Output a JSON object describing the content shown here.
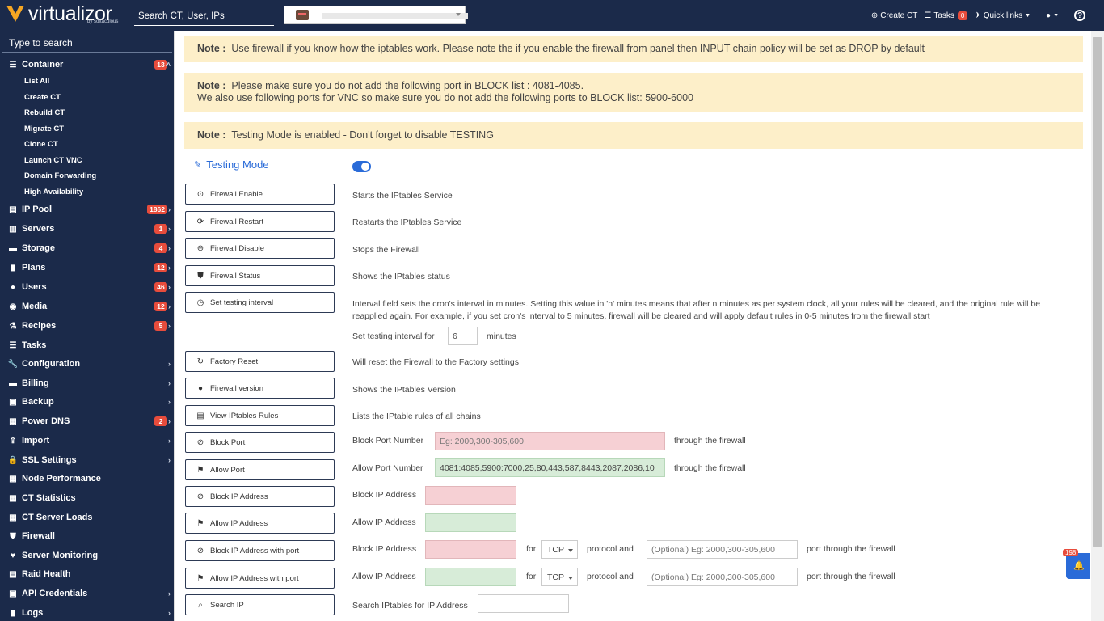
{
  "topbar": {
    "logo_text": "virtualizor",
    "logo_sub": "by softaculous",
    "search_placeholder": "Search CT, User, IPs",
    "create_ct": "Create CT",
    "tasks": "Tasks",
    "tasks_count": "0",
    "quick_links": "Quick links"
  },
  "sidebar": {
    "search_placeholder": "Type to search",
    "items": [
      {
        "label": "Container",
        "badge": "13",
        "icon": "container-icon"
      },
      {
        "label": "IP Pool",
        "badge": "1862",
        "icon": "ip-pool-icon"
      },
      {
        "label": "Servers",
        "badge": "1",
        "icon": "servers-icon"
      },
      {
        "label": "Storage",
        "badge": "4",
        "icon": "storage-icon"
      },
      {
        "label": "Plans",
        "badge": "12",
        "icon": "plans-icon"
      },
      {
        "label": "Users",
        "badge": "46",
        "icon": "users-icon"
      },
      {
        "label": "Media",
        "badge": "12",
        "icon": "media-icon"
      },
      {
        "label": "Recipes",
        "badge": "5",
        "icon": "recipes-icon"
      },
      {
        "label": "Tasks",
        "badge": "",
        "icon": "tasks-icon"
      },
      {
        "label": "Configuration",
        "badge": "",
        "icon": "wrench-icon"
      },
      {
        "label": "Billing",
        "badge": "",
        "icon": "billing-icon"
      },
      {
        "label": "Backup",
        "badge": "",
        "icon": "backup-icon"
      },
      {
        "label": "Power DNS",
        "badge": "2",
        "icon": "dns-icon"
      },
      {
        "label": "Import",
        "badge": "",
        "icon": "import-icon"
      },
      {
        "label": "SSL Settings",
        "badge": "",
        "icon": "lock-icon"
      },
      {
        "label": "Node Performance",
        "badge": "",
        "icon": "chart-icon"
      },
      {
        "label": "CT Statistics",
        "badge": "",
        "icon": "chart-icon"
      },
      {
        "label": "CT Server Loads",
        "badge": "",
        "icon": "chart-icon"
      },
      {
        "label": "Firewall",
        "badge": "",
        "icon": "shield-icon"
      },
      {
        "label": "Server Monitoring",
        "badge": "",
        "icon": "heart-icon"
      },
      {
        "label": "Raid Health",
        "badge": "",
        "icon": "raid-icon"
      },
      {
        "label": "API Credentials",
        "badge": "",
        "icon": "api-icon"
      },
      {
        "label": "Logs",
        "badge": "",
        "icon": "logs-icon"
      }
    ],
    "container_sub": [
      "List All",
      "Create CT",
      "Rebuild CT",
      "Migrate CT",
      "Clone CT",
      "Launch CT VNC",
      "Domain Forwarding",
      "High Availability"
    ]
  },
  "notes": {
    "label": "Note :",
    "note1": "Use firewall if you know how the iptables work. Please note the if you enable the firewall from panel then INPUT chain policy will be set as DROP by default",
    "note2_line1": "Please make sure you do not add the following port in BLOCK list : 4081-4085.",
    "note2_line2": "We also use following ports for VNC so make sure you do not add the following ports to BLOCK list: 5900-6000",
    "note3": "Testing Mode is enabled - Don't forget to disable TESTING"
  },
  "testing_mode": {
    "label": "Testing Mode",
    "enabled": true
  },
  "buttons": {
    "firewall_enable": "Firewall Enable",
    "firewall_restart": "Firewall Restart",
    "firewall_disable": "Firewall Disable",
    "firewall_status": "Firewall Status",
    "set_testing_interval": "Set testing interval",
    "factory_reset": "Factory Reset",
    "firewall_version": "Firewall version",
    "view_iptables_rules": "View IPtables Rules",
    "block_port": "Block Port",
    "allow_port": "Allow Port",
    "block_ip": "Block IP Address",
    "allow_ip": "Allow IP Address",
    "block_ip_port": "Block IP Address with port",
    "allow_ip_port": "Allow IP Address with port",
    "search_ip": "Search IP"
  },
  "descriptions": {
    "firewall_enable": "Starts the IPtables Service",
    "firewall_restart": "Restarts the IPtables Service",
    "firewall_disable": "Stops the Firewall",
    "firewall_status": "Shows the IPtables status",
    "interval_line1": "Interval field sets the cron's interval in minutes. Setting this value in 'n' minutes means that after n minutes as per system clock, all your rules will be cleared, and the original rule will be",
    "interval_line2": "reapplied again. For example, if you set cron's interval to 5 minutes, firewall will be cleared and will apply default rules in 0-5 minutes from the firewall start",
    "interval_label": "Set testing interval for",
    "interval_value": "6",
    "interval_unit": "minutes",
    "factory_reset": "Will reset the Firewall to the Factory settings",
    "firewall_version": "Shows the IPtables Version",
    "view_rules": "Lists the IPtable rules of all chains",
    "block_port_label": "Block Port Number",
    "block_port_placeholder": "Eg: 2000,300-305,600",
    "allow_port_label": "Allow Port Number",
    "allow_port_value": "4081:4085,5900:7000,25,80,443,587,8443,2087,2086,10",
    "through": "through the firewall",
    "block_ip_label": "Block IP Address",
    "allow_ip_label": "Allow IP Address",
    "for": "for",
    "protocol": "TCP",
    "protocol_and": "protocol and",
    "port_placeholder": "(Optional) Eg: 2000,300-305,600",
    "port_through": "port through the firewall",
    "search_label": "Search IPtables for IP Address"
  },
  "notification": {
    "count": "198"
  }
}
